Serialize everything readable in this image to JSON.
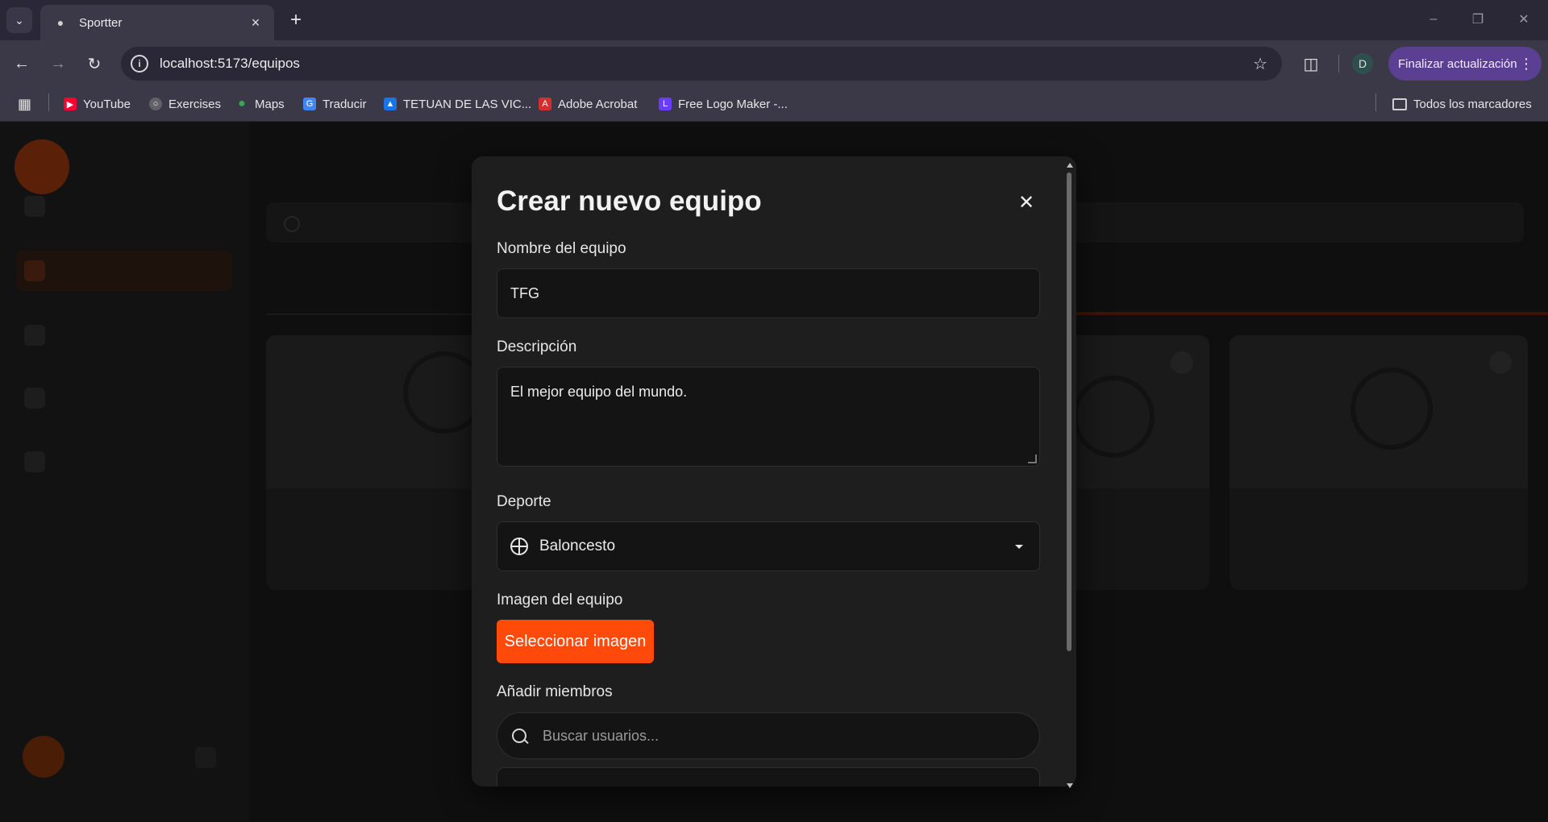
{
  "browser": {
    "tab_title": "Sportter",
    "url": "localhost:5173/equipos",
    "update_label": "Finalizar actualización",
    "profile_initial": "D",
    "bookmarks": [
      {
        "label": "YouTube",
        "icon": "youtube-icon",
        "color": "#ff0033"
      },
      {
        "label": "Exercises",
        "icon": "globe-icon",
        "color": "#5f6368"
      },
      {
        "label": "Maps",
        "icon": "maps-pin-icon",
        "color": "#34a853"
      },
      {
        "label": "Traducir",
        "icon": "translate-icon",
        "color": "#4285f4"
      },
      {
        "label": "TETUAN DE LAS VIC...",
        "icon": "graduation-cap-icon",
        "color": "#1a73e8"
      },
      {
        "label": "Adobe Acrobat",
        "icon": "acrobat-icon",
        "color": "#d32f2f"
      },
      {
        "label": "Free Logo Maker -...",
        "icon": "logo-maker-icon",
        "color": "#6a3cff"
      }
    ],
    "all_bookmarks_label": "Todos los marcadores"
  },
  "modal": {
    "title": "Crear nuevo equipo",
    "name_label": "Nombre del equipo",
    "name_value": "TFG",
    "description_label": "Descripción",
    "description_value": "El mejor equipo del mundo.",
    "sport_label": "Deporte",
    "sport_value": "Baloncesto",
    "image_label": "Imagen del equipo",
    "image_button": "Seleccionar imagen",
    "members_label": "Añadir miembros",
    "members_placeholder": "Buscar usuarios...",
    "accent_color": "#ff4a0a"
  }
}
